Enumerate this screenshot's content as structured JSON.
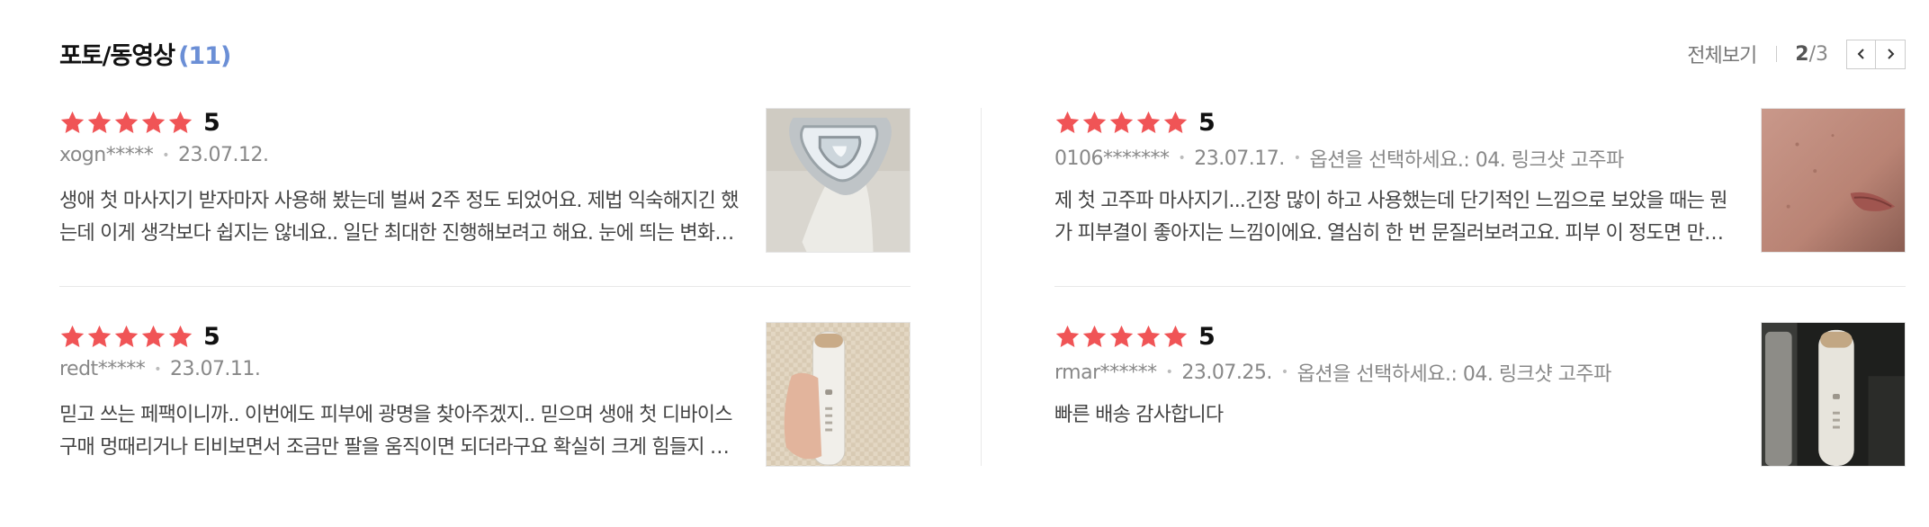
{
  "header": {
    "title": "포토/동영상",
    "count": "(11)",
    "view_all": "전체보기",
    "page_current": "2",
    "page_total": "/3"
  },
  "colors": {
    "star": "#f05456",
    "count": "#6b8fd6"
  },
  "reviews": [
    {
      "rating": "5",
      "user": "xogn*****",
      "date": "23.07.12.",
      "option": "",
      "text": "생애 첫 마사지기 받자마자 사용해 봤는데 벌써 2주 정도 되었어요. 제법 익숙해지긴 했는데 이게 생각보다 쉽지는 않네요.. 일단 최대한 진행해보려고 해요. 눈에 띄는 변화를 기대해 봅니다.",
      "thumb": "device-head-photo"
    },
    {
      "rating": "5",
      "user": "0106*******",
      "date": "23.07.17.",
      "option": "옵션을 선택하세요.: 04. 링크샷 고주파",
      "text": "제 첫 고주파 마사지기...긴장 많이 하고 사용했는데 단기적인 느낌으로 보았을 때는 뭔가 피부결이 좋아지는 느낌이에요. 열심히 한 번 문질러보려고요. 피부 이 정도면 만족해요.",
      "thumb": "skin-closeup-photo"
    },
    {
      "rating": "5",
      "user": "redt*****",
      "date": "23.07.11.",
      "option": "",
      "text": "믿고 쓰는 페팩이니까.. 이번에도 피부에 광명을 찾아주겠지.. 믿으며 생애 첫 디바이스 구매 멍때리거나 티비보면서 조금만 팔을 움직이면 되더라구요 확실히 크게 힘들지 않아요.",
      "thumb": "device-in-hand-photo"
    },
    {
      "rating": "5",
      "user": "rmar******",
      "date": "23.07.25.",
      "option": "옵션을 선택하세요.: 04. 링크샷 고주파",
      "text": "빠른 배송 감사합니다",
      "thumb": "device-standing-photo"
    }
  ]
}
